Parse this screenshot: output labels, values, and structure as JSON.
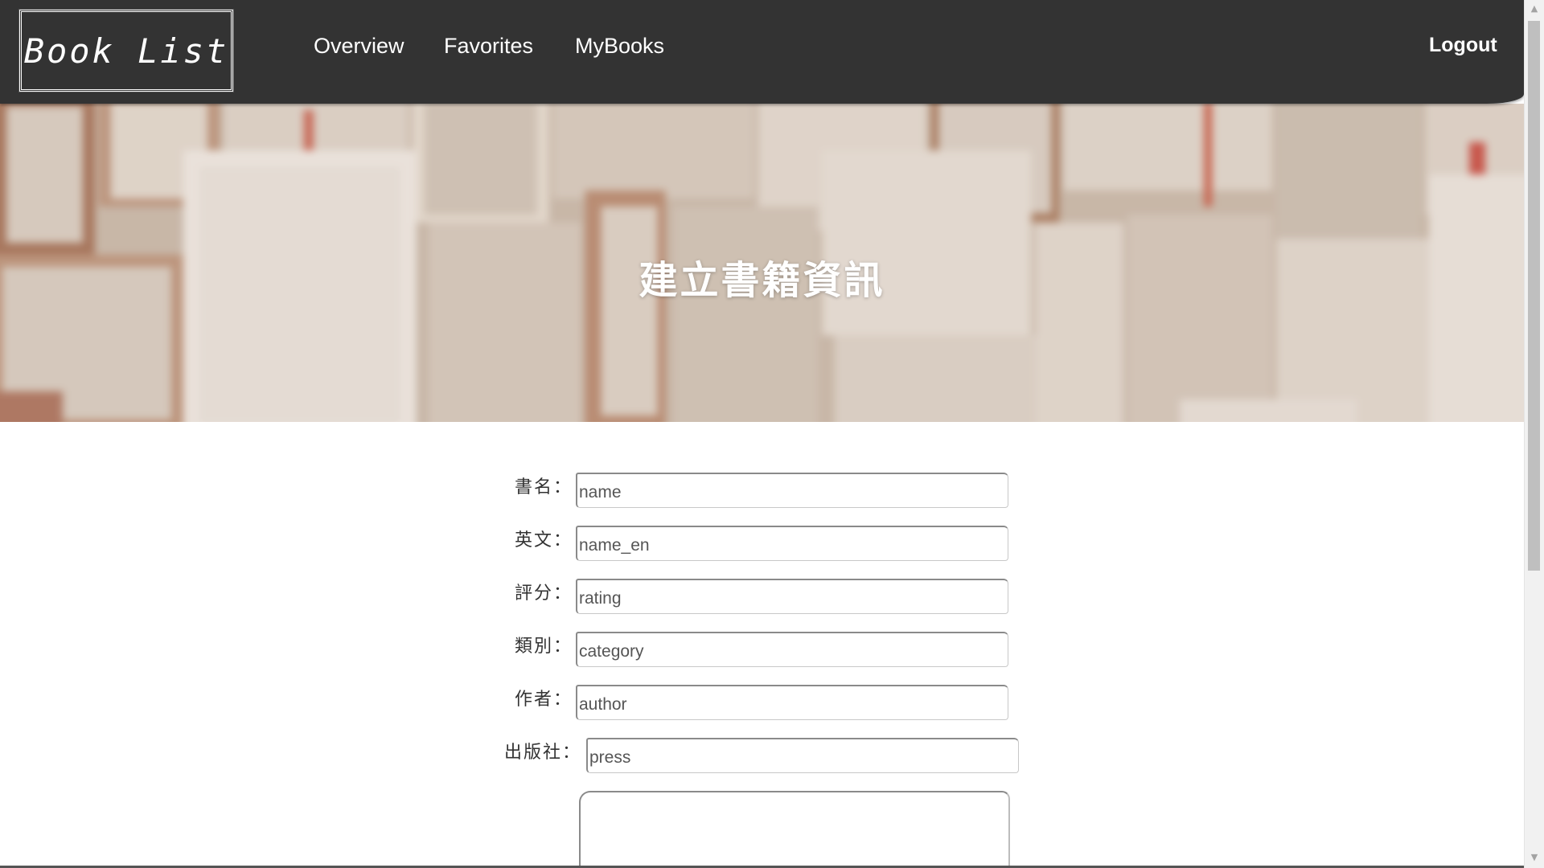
{
  "navbar": {
    "brand": "Book List",
    "links": {
      "overview": "Overview",
      "favorites": "Favorites",
      "mybooks": "MyBooks"
    },
    "logout": "Logout"
  },
  "banner": {
    "title": "建立書籍資訊"
  },
  "form": {
    "fields": [
      {
        "label": "書名：",
        "placeholder": "name",
        "value": ""
      },
      {
        "label": "英文：",
        "placeholder": "name_en",
        "value": ""
      },
      {
        "label": "評分：",
        "placeholder": "rating",
        "value": ""
      },
      {
        "label": "類別：",
        "placeholder": "category",
        "value": ""
      },
      {
        "label": "作者：",
        "placeholder": "author",
        "value": ""
      },
      {
        "label": "出版社：",
        "placeholder": "press",
        "value": ""
      }
    ],
    "description": {
      "value": ""
    }
  },
  "colors": {
    "navbar_bg": "#333333",
    "text_light": "#ffffff",
    "label_text": "#333333"
  }
}
